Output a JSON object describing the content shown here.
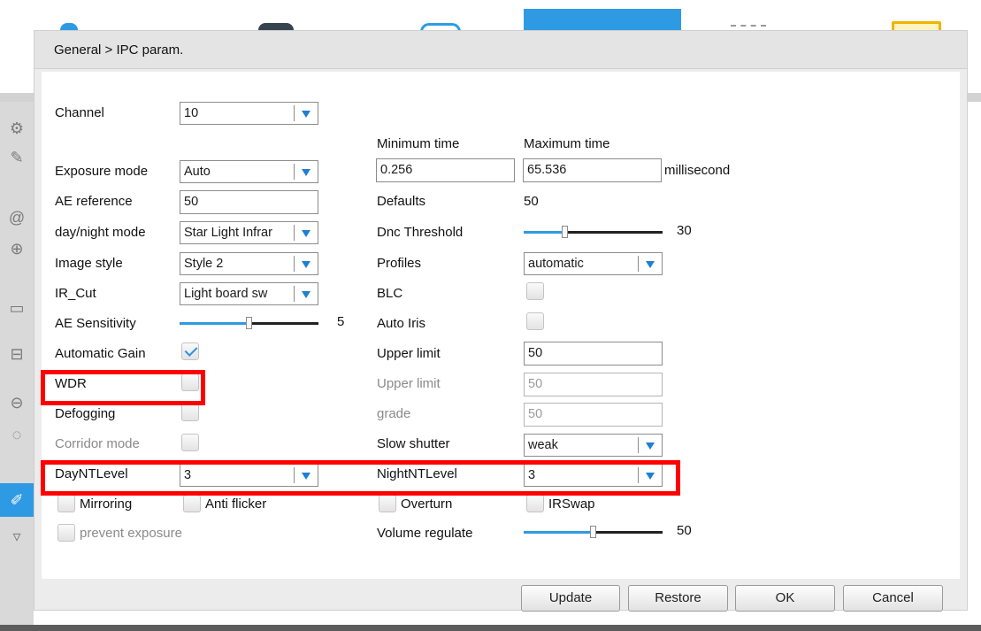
{
  "title": "General > IPC param.",
  "colors": {
    "accent": "#2f9ae4",
    "highlight": "#ff0000",
    "dialog_bg": "#ececec"
  },
  "fields": {
    "channel": {
      "label": "Channel",
      "value": "10"
    },
    "min_time_header": "Minimum time",
    "max_time_header": "Maximum time",
    "exposure_mode": {
      "label": "Exposure mode",
      "value": "Auto",
      "min": "0.256",
      "max": "65.536",
      "unit": "millisecond"
    },
    "ae_reference": {
      "label": "AE reference",
      "value": "50",
      "defaults_label": "Defaults",
      "defaults_value": "50"
    },
    "day_night_mode": {
      "label": "day/night mode",
      "value": "Star Light Infrar"
    },
    "dnc_threshold": {
      "label": "Dnc Threshold",
      "value": "30",
      "level": 0.3
    },
    "image_style": {
      "label": "Image style",
      "value": "Style 2"
    },
    "profiles": {
      "label": "Profiles",
      "value": "automatic"
    },
    "ir_cut": {
      "label": "IR_Cut",
      "value": "Light board sw"
    },
    "blc": {
      "label": "BLC",
      "checked": false
    },
    "ae_sensitivity": {
      "label": "AE Sensitivity",
      "value": "5",
      "level": 0.5
    },
    "auto_iris": {
      "label": "Auto Iris",
      "checked": false
    },
    "automatic_gain": {
      "label": "Automatic Gain",
      "checked": true
    },
    "upper_limit": {
      "label": "Upper limit",
      "value": "50"
    },
    "wdr": {
      "label": "WDR",
      "checked": false
    },
    "upper_limit_2": {
      "label": "Upper limit",
      "value": "50"
    },
    "defogging": {
      "label": "Defogging",
      "checked": false
    },
    "grade": {
      "label": "grade",
      "value": "50"
    },
    "corridor_mode": {
      "label": "Corridor mode",
      "checked": false
    },
    "slow_shutter": {
      "label": "Slow shutter",
      "value": "weak"
    },
    "day_nt_level": {
      "label": "DayNTLevel",
      "value": "3"
    },
    "night_nt_level": {
      "label": "NightNTLevel",
      "value": "3"
    },
    "mirroring": {
      "label": "Mirroring",
      "checked": false
    },
    "anti_flicker": {
      "label": "Anti flicker",
      "checked": false
    },
    "overturn": {
      "label": "Overturn",
      "checked": false
    },
    "ir_swap": {
      "label": "IRSwap",
      "checked": false
    },
    "prevent_exposure": {
      "label": "prevent exposure",
      "checked": false
    },
    "volume_regulate": {
      "label": "Volume regulate",
      "value": "50",
      "level": 0.5
    }
  },
  "buttons": {
    "update": "Update",
    "restore": "Restore",
    "ok": "OK",
    "cancel": "Cancel"
  }
}
